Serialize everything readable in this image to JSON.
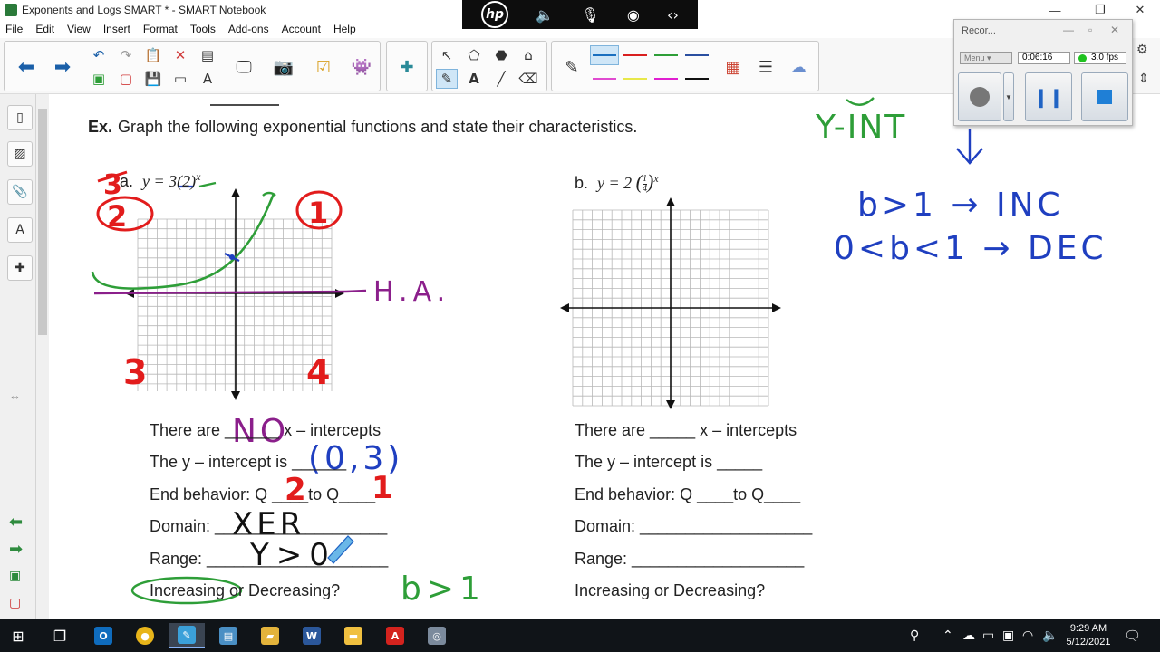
{
  "window": {
    "title": "Exponents and Logs SMART * - SMART Notebook",
    "controls": {
      "minimize": "—",
      "restore": "❐",
      "close": "✕"
    }
  },
  "overlay": {
    "logo": "hp",
    "icons": [
      "speaker-mute-icon",
      "mic-mute-icon",
      "broadcast-icon",
      "code-icon"
    ]
  },
  "menu": [
    "File",
    "Edit",
    "View",
    "Insert",
    "Format",
    "Tools",
    "Add-ons",
    "Account",
    "Help"
  ],
  "toolbar": {
    "pen_colors": [
      "#1a6fbf",
      "#d91f1f",
      "#2e9e38",
      "#2a4fa0"
    ],
    "pen_colors_row2": [
      "#e04bd0",
      "#e8e84a",
      "#e01fd0",
      "#111111"
    ]
  },
  "recorder": {
    "title": "Recor...",
    "menu_label": "Menu",
    "time": "0:06:16",
    "fps": "3.0 fps"
  },
  "worksheet": {
    "heading_bold": "Ex.",
    "heading_text": "Graph the following exponential functions and state their characteristics.",
    "problem_a": {
      "label": "a.",
      "equation": "y = 3(2)",
      "exponent": "x"
    },
    "problem_b": {
      "label": "b.",
      "equation": "y = 2",
      "fraction_num": "1",
      "fraction_den": "4",
      "exponent": "x"
    },
    "questions_a": [
      "There are ______ x – intercepts",
      "The y – intercept is ______",
      "End behavior: Q ____to Q____",
      "Domain: ___________________",
      "Range: ____________________",
      "Increasing or Decreasing?"
    ],
    "questions_b": [
      "There are _____ x – intercepts",
      "The y – intercept is _____",
      "End behavior: Q ____to Q____",
      "Domain: ___________________",
      "Range: ___________________",
      "Increasing or Decreasing?"
    ],
    "annotations": {
      "quadrant_tl": "2",
      "quadrant_tl_crossed": "3",
      "quadrant_tr": "1",
      "quadrant_bl": "3",
      "quadrant_br": "4",
      "asymptote": "H.A.",
      "no_intercepts": "NO",
      "y_intercept": "(0,3)",
      "end_left": "2",
      "end_right": "1",
      "domain": "XER",
      "range": "Y>0",
      "b_gt_1": "b>1",
      "y_int_label": "Y-INT",
      "rule_inc": "b>1 → INC",
      "rule_dec": "0<b<1 → DEC"
    }
  },
  "taskbar": {
    "apps": [
      "outlook-icon",
      "chrome-icon",
      "smart-notebook-icon",
      "screen-capture-icon",
      "file-explorer-icon",
      "word-icon",
      "folder-icon",
      "acrobat-icon",
      "recorder-icon"
    ],
    "time": "9:29 AM",
    "date": "5/12/2021"
  }
}
